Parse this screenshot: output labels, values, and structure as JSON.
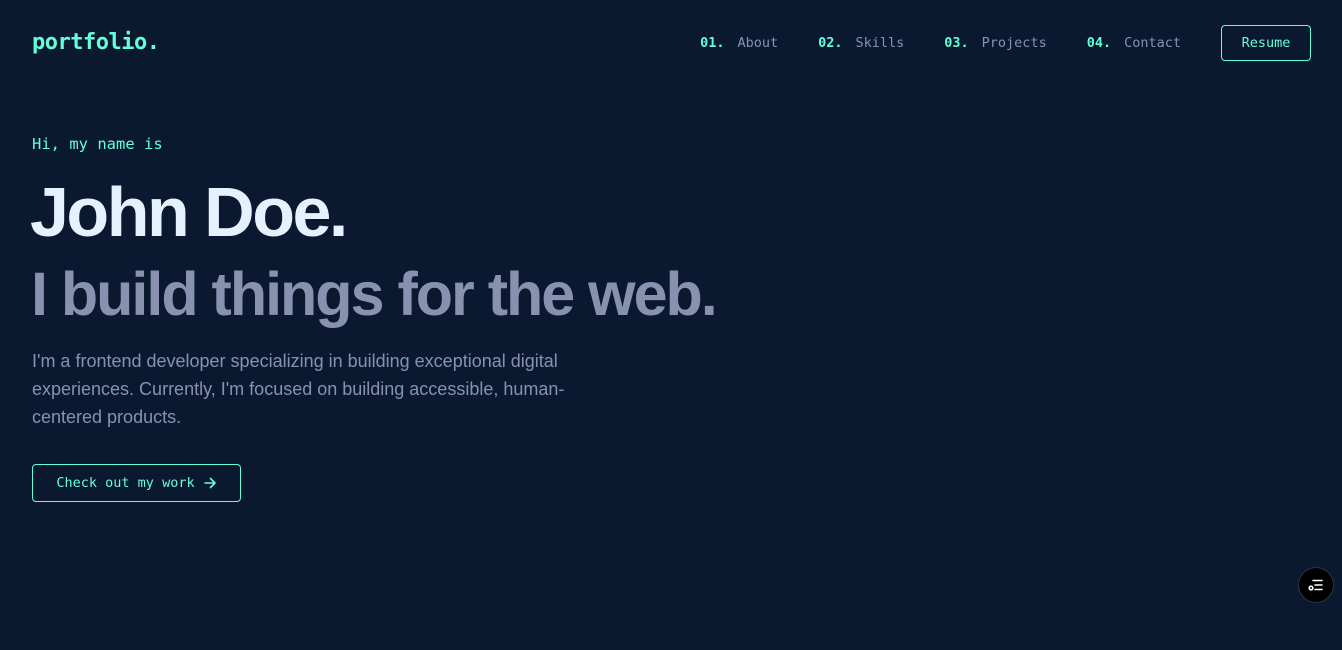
{
  "logo": {
    "text": "portfolio."
  },
  "nav": {
    "items": [
      {
        "number": "01.",
        "label": "About"
      },
      {
        "number": "02.",
        "label": "Skills"
      },
      {
        "number": "03.",
        "label": "Projects"
      },
      {
        "number": "04.",
        "label": "Contact"
      }
    ],
    "resume_label": "Resume"
  },
  "hero": {
    "greeting": "Hi, my name is",
    "name": "John Doe.",
    "tagline": "I build things for the web.",
    "bio": "I'm a frontend developer specializing in building exceptional digital experiences. Currently, I'm focused on building accessible, human-centered products.",
    "cta_label": "Check out my work",
    "cta_icon": "arrow-right-icon"
  },
  "floating_button": {
    "icon": "filter-list-icon"
  },
  "colors": {
    "background": "#0a192f",
    "accent": "#64ffda",
    "heading": "#e6f1ff",
    "muted": "#8892b0"
  }
}
